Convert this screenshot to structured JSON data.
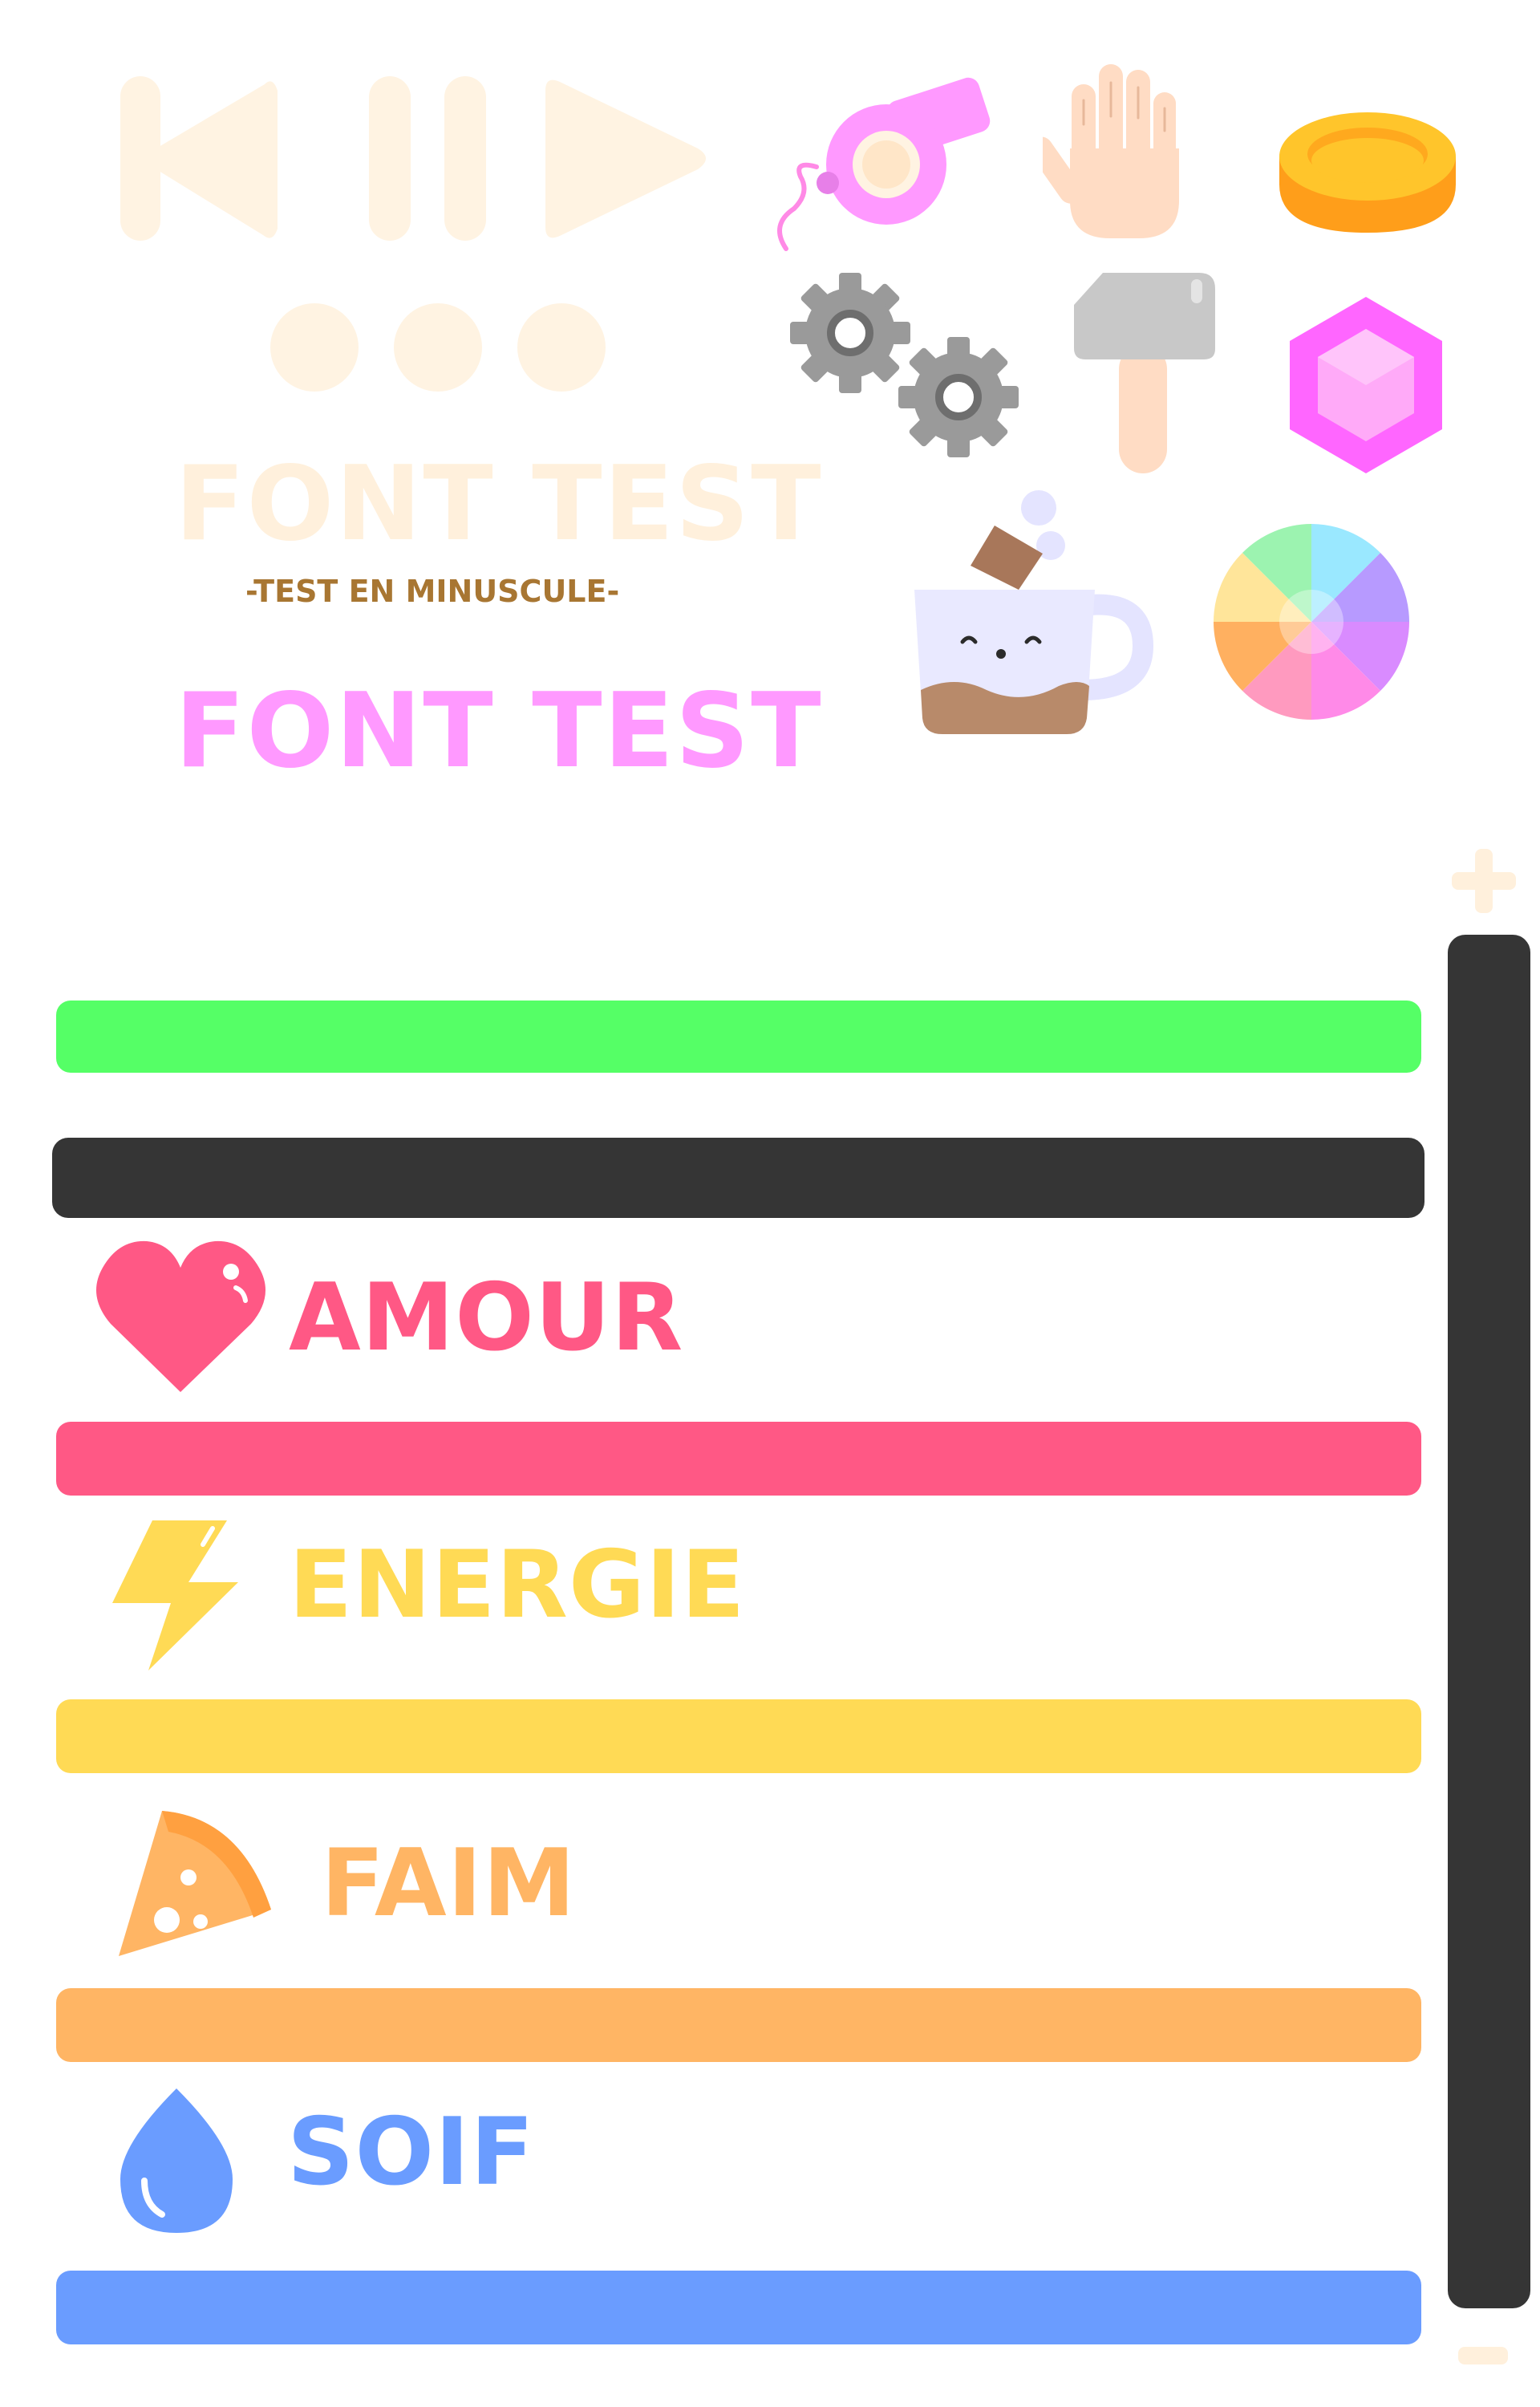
{
  "media_controls": {
    "icons": [
      "skip-back-icon",
      "pause-icon",
      "play-icon",
      "more-dots-icon"
    ],
    "color": "#FFF3E2"
  },
  "font_test": {
    "title": "FONT TEST",
    "subtitle": "-TEST EN MINUSCULE-",
    "title_pink": "FONT TEST",
    "title_color": "#FFF0DC",
    "subtitle_color": "#A87632",
    "pink_color": "#FF99FF"
  },
  "icon_grid": [
    "whistle-icon",
    "hand-icon",
    "coin-icon",
    "gears-icon",
    "hammer-icon",
    "gem-icon",
    "coffee-mug-icon",
    "color-wheel-icon"
  ],
  "scroll": {
    "plus_label": "+",
    "minus_label": "-",
    "accent": "#FFF0DC",
    "track_color": "#353535"
  },
  "bars": {
    "green_color": "#55FF66",
    "dark_color": "#353535"
  },
  "stats": [
    {
      "label": "AMOUR",
      "icon": "heart-icon",
      "color": "#FF5885"
    },
    {
      "label": "ENERGIE",
      "icon": "lightning-icon",
      "color": "#FFDA55"
    },
    {
      "label": "FAIM",
      "icon": "pizza-icon",
      "color": "#FFB564"
    },
    {
      "label": "SOIF",
      "icon": "water-drop-icon",
      "color": "#6A9CFF"
    }
  ]
}
